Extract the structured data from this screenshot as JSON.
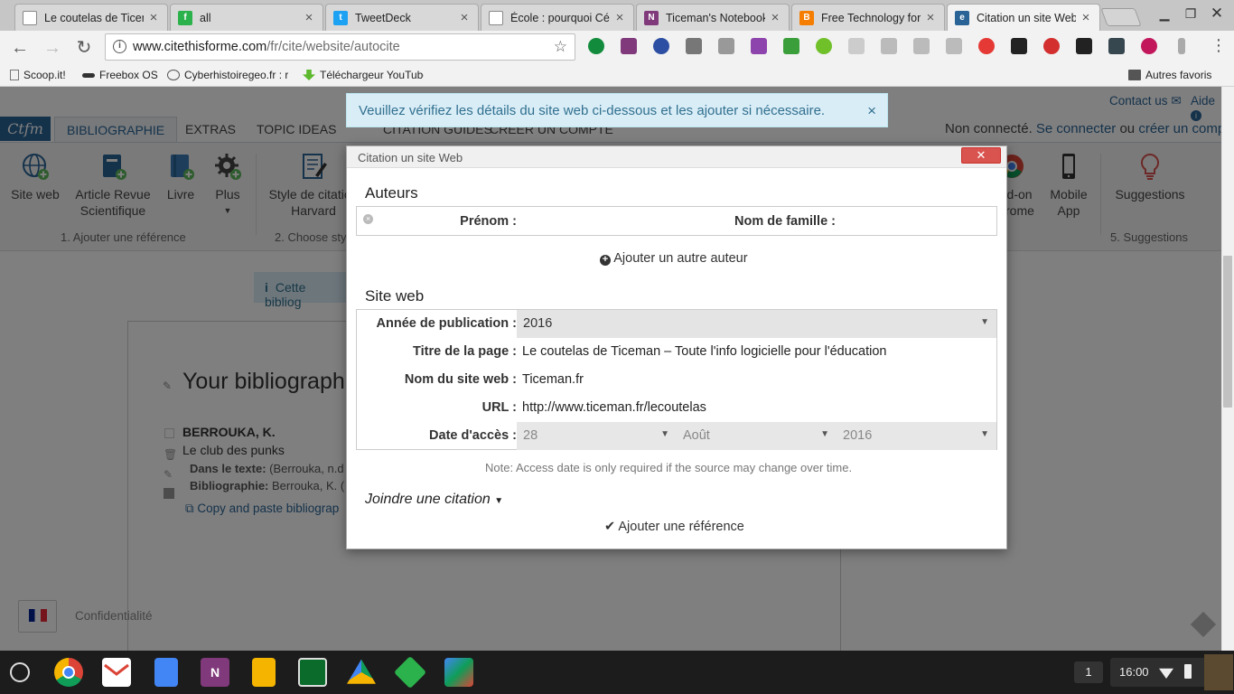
{
  "browser": {
    "tabs": [
      {
        "label": "Le coutelas de Ticem",
        "icon": "page-icon",
        "color": "#ffffff"
      },
      {
        "label": "all",
        "icon": "feedly-icon",
        "color": "#2bb24c"
      },
      {
        "label": "TweetDeck",
        "icon": "twitter-icon",
        "color": "#1da1f2"
      },
      {
        "label": "École : pourquoi Cé",
        "icon": "page-icon",
        "color": "#ffffff"
      },
      {
        "label": "Ticeman's Notebook",
        "icon": "onenote-icon",
        "color": "#80397b"
      },
      {
        "label": "Free Technology for",
        "icon": "blogger-icon",
        "color": "#f57d00"
      },
      {
        "label": "Citation un site Web",
        "icon": "citethisforme-icon",
        "color": "#2a6496"
      }
    ],
    "url_host": "www.citethisforme.com",
    "url_path": "/fr/cite/website/autocite",
    "bookmarks": [
      {
        "label": "Scoop.it!"
      },
      {
        "label": "Freebox OS"
      },
      {
        "label": "Cyberhistoiregeo.fr : r"
      },
      {
        "label": "Téléchargeur YouTube"
      }
    ],
    "other_bookmarks": "Autres favoris"
  },
  "site": {
    "contact": "Contact us",
    "help": "Aide",
    "logo": "Ctfm",
    "nav": [
      "BIBLIOGRAPHIE",
      "EXTRAS",
      "TOPIC IDEAS",
      "CITATION GUIDES",
      "CRÉER UN COMPTE"
    ],
    "login_status": "Non connecté.",
    "login_link": "Se connecter",
    "login_or": "ou",
    "register_link": "créer un compte",
    "ribbon": {
      "site_web": "Site web",
      "article": "Article Revue Scientifique",
      "livre": "Livre",
      "plus": "Plus",
      "style": "Style de citation Harvard",
      "addon": "Add-on Chrome",
      "mobile": "Mobile App",
      "suggestions": "Suggestions",
      "group1": "1. Ajouter une référence",
      "group2": "2. Choose sty",
      "group5": "5. Suggestions"
    },
    "alert": "Veuillez vérifiez les détails du site web ci-dessous et les ajouter si nécessaire.",
    "info_box": "Cette bibliog",
    "bibliography": {
      "title": "Your bibliograph",
      "author": "BERROUKA, K.",
      "work": "Le club des punks",
      "intext_label": "Dans le texte:",
      "intext_value": "(Berrouka, n.d",
      "biblio_label": "Bibliographie:",
      "biblio_value": "Berrouka, K. (",
      "copy_link": "Copy and paste bibliograp"
    },
    "privacy": "Confidentialité"
  },
  "dialog": {
    "title": "Citation un site Web",
    "authors_heading": "Auteurs",
    "first_name_label": "Prénom :",
    "last_name_label": "Nom de famille :",
    "add_author": "Ajouter un autre auteur",
    "website_heading": "Site web",
    "year_label": "Année de publication :",
    "year_value": "2016",
    "page_title_label": "Titre de la page :",
    "page_title_value": "Le coutelas de Ticeman – Toute l'info logicielle pour l'éducation",
    "site_name_label": "Nom du site web :",
    "site_name_value": "Ticeman.fr",
    "url_label": "URL :",
    "url_value": "http://www.ticeman.fr/lecoutelas",
    "access_date_label": "Date d'accès :",
    "access_day": "28",
    "access_month": "Août",
    "access_year": "2016",
    "note": "Note: Access date is only required if the source may change over time.",
    "quote_toggle": "Joindre une citation",
    "submit": "Ajouter une référence"
  },
  "taskbar": {
    "notifications": "1",
    "time": "16:00"
  },
  "colors": {
    "accent": "#2a6496",
    "alert_bg": "#d9edf7",
    "close_red": "#d9534f"
  }
}
